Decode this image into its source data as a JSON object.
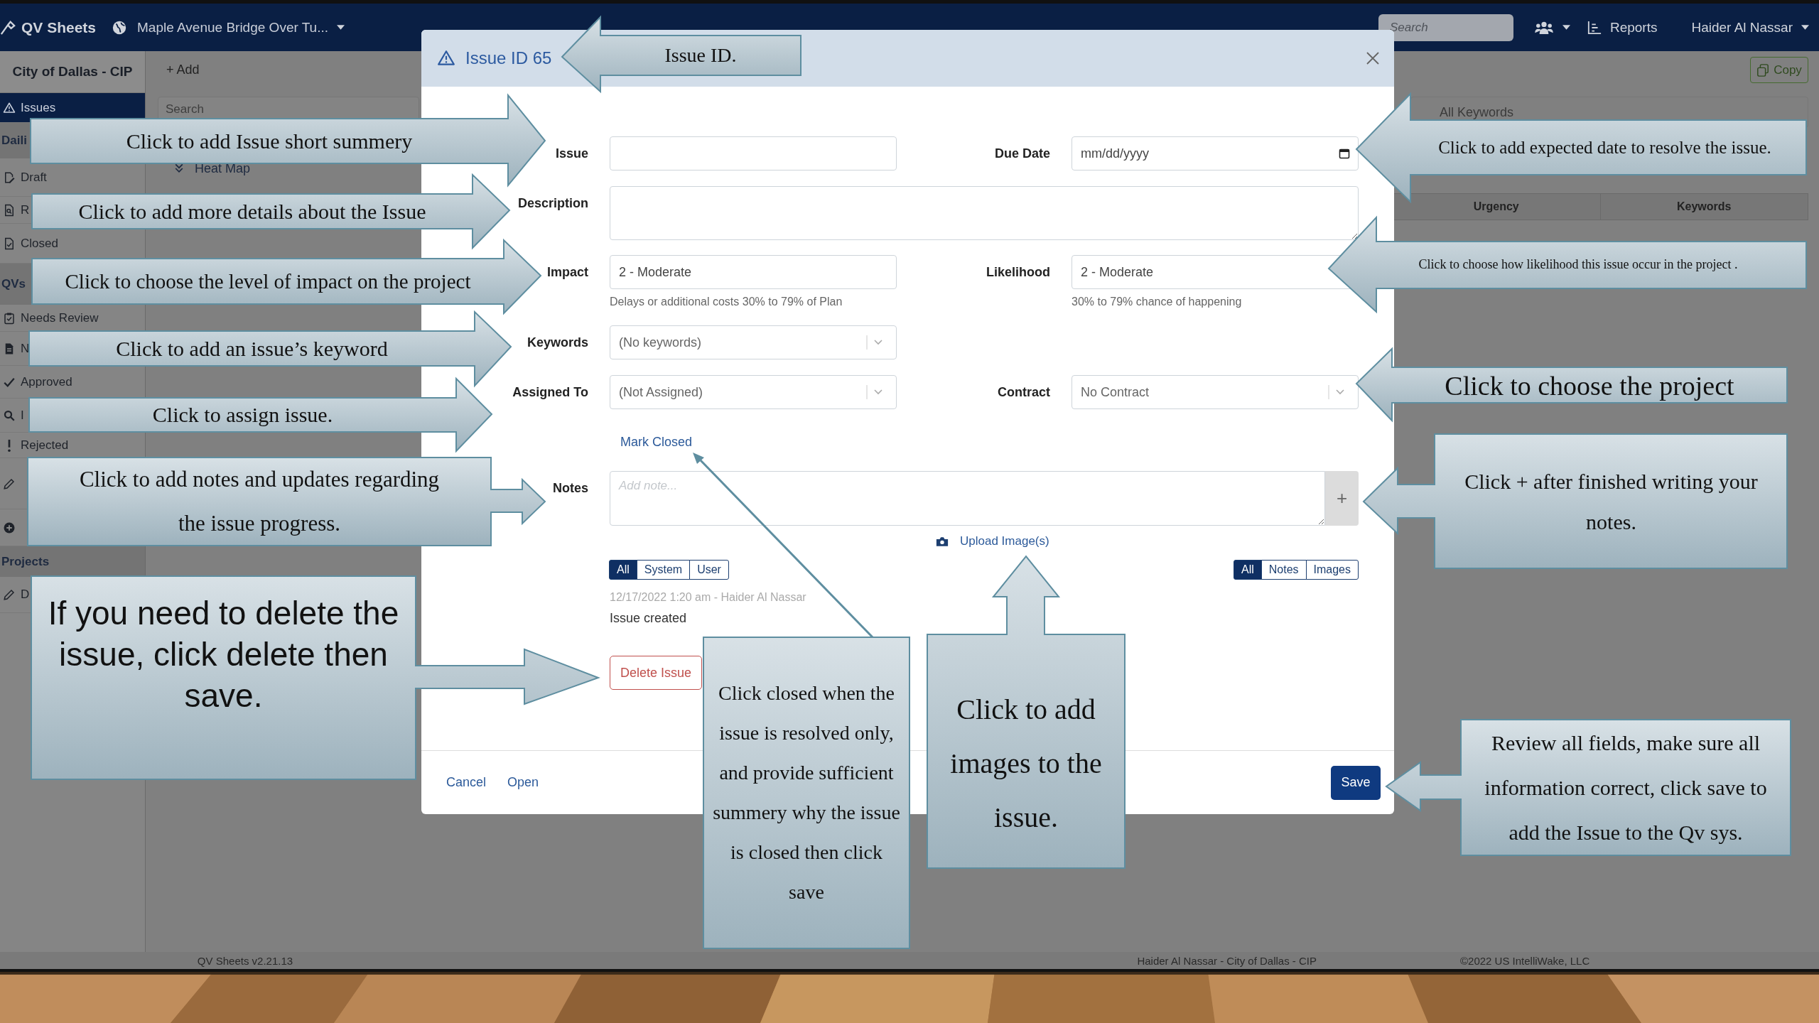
{
  "topbar": {
    "brand": "QV Sheets",
    "project": "Maple Avenue Bridge Over Tu...",
    "search": {
      "placeholder": "Search"
    },
    "reports": "Reports",
    "user": "Haider Al Nassar"
  },
  "sidebar": {
    "header": "City of Dallas - CIP",
    "items": [
      {
        "kind": "item",
        "label": "Issues",
        "selected": true
      },
      {
        "kind": "section",
        "label": "Daili"
      },
      {
        "kind": "item",
        "label": "Draft",
        "selected": false
      },
      {
        "kind": "item",
        "label": "R",
        "selected": false
      },
      {
        "kind": "item",
        "label": "Closed",
        "selected": false
      },
      {
        "kind": "section",
        "label": "QVs"
      },
      {
        "kind": "item",
        "label": "Needs Review",
        "selected": false
      },
      {
        "kind": "item",
        "label": "N",
        "selected": false
      },
      {
        "kind": "item",
        "label": "Approved",
        "selected": false
      },
      {
        "kind": "item",
        "label": "I",
        "selected": false
      },
      {
        "kind": "item",
        "label": "Rejected",
        "selected": false
      },
      {
        "kind": "item",
        "selected": false
      },
      {
        "kind": "item",
        "selected": false
      },
      {
        "kind": "section",
        "label": "Projects"
      },
      {
        "kind": "item",
        "label": "D",
        "selected": false
      }
    ]
  },
  "toolbar": {
    "add": "+ Add",
    "copy": "Copy",
    "search": {
      "placeholder": "Search"
    },
    "keywords_filter": "All Keywords",
    "heat_map": "Heat Map"
  },
  "table": {
    "columns": [
      "Urgency",
      "Keywords"
    ]
  },
  "dialog": {
    "title": "Issue ID 65",
    "issue": {
      "label": "Issue"
    },
    "due_date": {
      "label": "Due Date",
      "placeholder": "mm/dd/yyyy"
    },
    "description": {
      "label": "Description"
    },
    "impact": {
      "label": "Impact",
      "value": "2 - Moderate",
      "help": "Delays or additional costs 30% to 79% of Plan"
    },
    "likelihood": {
      "label": "Likelihood",
      "value": "2 - Moderate",
      "help": "30% to 79% chance of happening"
    },
    "keywords": {
      "label": "Keywords",
      "value": "(No keywords)"
    },
    "assigned_to": {
      "label": "Assigned To",
      "value": "(Not Assigned)"
    },
    "contract": {
      "label": "Contract",
      "value": "No Contract"
    },
    "mark_closed": "Mark Closed",
    "notes": {
      "label": "Notes",
      "placeholder": "Add note...",
      "add_button": "+"
    },
    "upload": "Upload Image(s)",
    "history_filter": [
      {
        "label": "All",
        "selected": true
      },
      {
        "label": "System",
        "selected": false
      },
      {
        "label": "User",
        "selected": false
      }
    ],
    "content_filter": [
      {
        "label": "All",
        "selected": true
      },
      {
        "label": "Notes",
        "selected": false
      },
      {
        "label": "Images",
        "selected": false
      }
    ],
    "history": [
      {
        "meta": "12/17/2022 1:20 am - Haider Al Nassar",
        "text": "Issue created"
      }
    ],
    "delete": "Delete Issue",
    "cancel": "Cancel",
    "open": "Open",
    "save": "Save"
  },
  "callouts": [
    {
      "text": "Issue ID."
    },
    {
      "text": "Click to add Issue short summery"
    },
    {
      "text": "Click to add expected date to resolve the issue."
    },
    {
      "text": "Click to add  more details about the Issue"
    },
    {
      "text": "Click to choose the level of impact on the project"
    },
    {
      "text": "Click to choose how likelihood this issue occur in the project ."
    },
    {
      "text": "Click to add  an issue’s keyword"
    },
    {
      "text": "Click to assign issue."
    },
    {
      "text": "Click to choose the project"
    },
    {
      "text": "Click to add notes and updates regarding the issue progress."
    },
    {
      "text": "Click + after finished writing your notes."
    },
    {
      "text": "If you need to delete the issue, click delete then save."
    },
    {
      "text": "Click closed when the issue is resolved only, and provide sufficient summery why the issue is closed then click save"
    },
    {
      "text": "Click to add images to the issue."
    },
    {
      "text": "Review all fields, make sure all information correct, click save to add the Issue to the Qv sys."
    }
  ],
  "footer": {
    "version": "QV Sheets v2.21.13",
    "center": "Haider Al Nassar - City of Dallas - CIP",
    "copyright": "©2022 US IntelliWake, LLC"
  }
}
